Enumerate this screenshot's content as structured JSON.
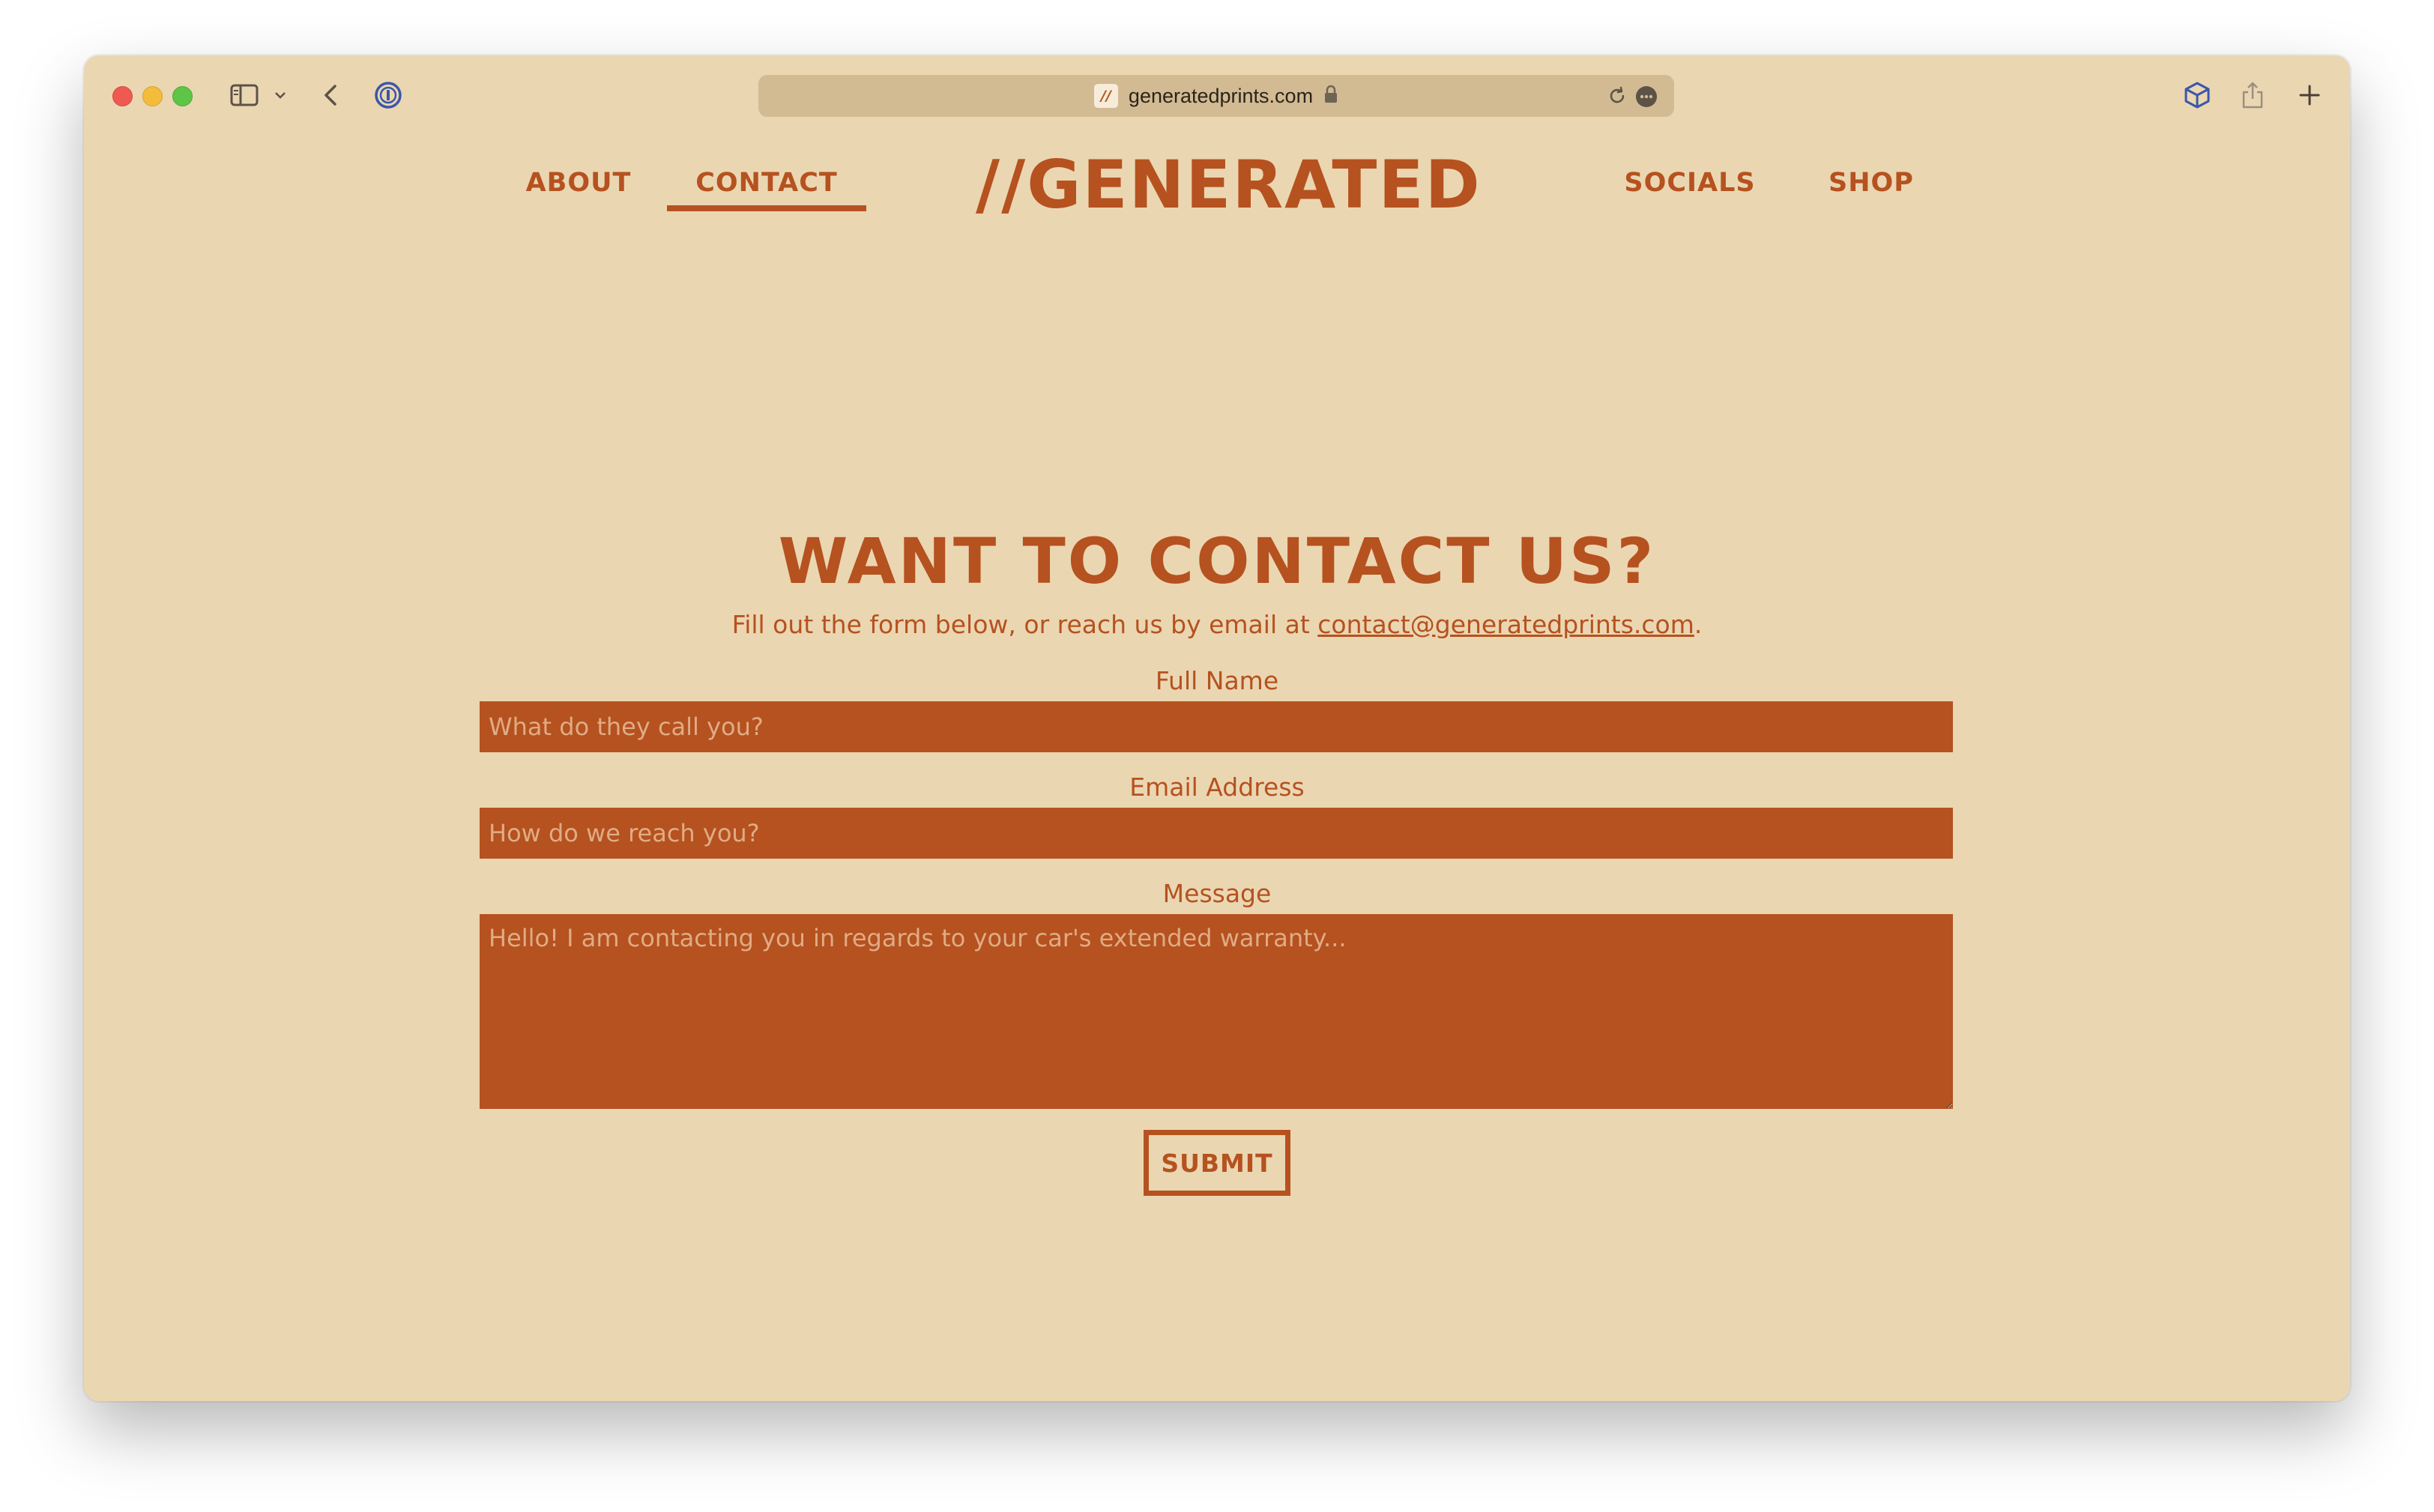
{
  "browser": {
    "url": "generatedprints.com",
    "favicon_text": "//"
  },
  "nav": {
    "about": "ABOUT",
    "contact": "CONTACT",
    "logo": "//GENERATED",
    "socials": "SOCIALS",
    "shop": "SHOP",
    "active": "contact"
  },
  "contact": {
    "heading": "WANT TO CONTACT US?",
    "intro": "Fill out the form below, or reach us by email at ",
    "email": "contact@generatedprints.com",
    "intro_end": ".",
    "full_name_label": "Full Name",
    "full_name_placeholder": "What do they call you?",
    "email_label": "Email Address",
    "email_placeholder": "How do we reach you?",
    "message_label": "Message",
    "message_placeholder": "Hello! I am contacting you in regards to your car's extended warranty...",
    "submit_label": "SUBMIT"
  },
  "colors": {
    "background": "#ebd6b2",
    "accent": "#b5521f",
    "address_bar": "#d2ba93"
  }
}
